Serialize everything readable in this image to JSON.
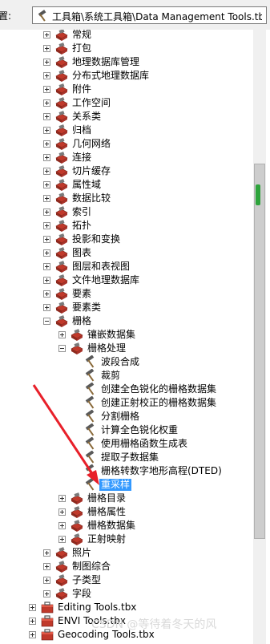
{
  "location_bar": {
    "label": "置:",
    "value": "工具箱\\系统工具箱\\Data Management Tools.tbx\\栅"
  },
  "tree": [
    {
      "label": "常规",
      "level": 1,
      "expand": "plus",
      "icon": "toolset"
    },
    {
      "label": "打包",
      "level": 1,
      "expand": "plus",
      "icon": "toolset"
    },
    {
      "label": "地理数据库管理",
      "level": 1,
      "expand": "plus",
      "icon": "toolset"
    },
    {
      "label": "分布式地理数据库",
      "level": 1,
      "expand": "plus",
      "icon": "toolset"
    },
    {
      "label": "附件",
      "level": 1,
      "expand": "plus",
      "icon": "toolset"
    },
    {
      "label": "工作空间",
      "level": 1,
      "expand": "plus",
      "icon": "toolset"
    },
    {
      "label": "关系类",
      "level": 1,
      "expand": "plus",
      "icon": "toolset"
    },
    {
      "label": "归档",
      "level": 1,
      "expand": "plus",
      "icon": "toolset"
    },
    {
      "label": "几何网络",
      "level": 1,
      "expand": "plus",
      "icon": "toolset"
    },
    {
      "label": "连接",
      "level": 1,
      "expand": "plus",
      "icon": "toolset"
    },
    {
      "label": "切片缓存",
      "level": 1,
      "expand": "plus",
      "icon": "toolset"
    },
    {
      "label": "属性域",
      "level": 1,
      "expand": "plus",
      "icon": "toolset"
    },
    {
      "label": "数据比较",
      "level": 1,
      "expand": "plus",
      "icon": "toolset"
    },
    {
      "label": "索引",
      "level": 1,
      "expand": "plus",
      "icon": "toolset"
    },
    {
      "label": "拓扑",
      "level": 1,
      "expand": "plus",
      "icon": "toolset"
    },
    {
      "label": "投影和变换",
      "level": 1,
      "expand": "plus",
      "icon": "toolset"
    },
    {
      "label": "图表",
      "level": 1,
      "expand": "plus",
      "icon": "toolset"
    },
    {
      "label": "图层和表视图",
      "level": 1,
      "expand": "plus",
      "icon": "toolset"
    },
    {
      "label": "文件地理数据库",
      "level": 1,
      "expand": "plus",
      "icon": "toolset"
    },
    {
      "label": "要素",
      "level": 1,
      "expand": "plus",
      "icon": "toolset"
    },
    {
      "label": "要素类",
      "level": 1,
      "expand": "plus",
      "icon": "toolset"
    },
    {
      "label": "栅格",
      "level": 1,
      "expand": "minus",
      "icon": "toolset"
    },
    {
      "label": "镶嵌数据集",
      "level": 2,
      "expand": "plus",
      "icon": "toolset"
    },
    {
      "label": "栅格处理",
      "level": 2,
      "expand": "minus",
      "icon": "toolset"
    },
    {
      "label": "波段合成",
      "level": 3,
      "expand": "none",
      "icon": "tool"
    },
    {
      "label": "裁剪",
      "level": 3,
      "expand": "none",
      "icon": "tool"
    },
    {
      "label": "创建全色锐化的栅格数据集",
      "level": 3,
      "expand": "none",
      "icon": "tool"
    },
    {
      "label": "创建正射校正的栅格数据集",
      "level": 3,
      "expand": "none",
      "icon": "tool"
    },
    {
      "label": "分割栅格",
      "level": 3,
      "expand": "none",
      "icon": "tool"
    },
    {
      "label": "计算全色锐化权重",
      "level": 3,
      "expand": "none",
      "icon": "tool"
    },
    {
      "label": "使用栅格函数生成表",
      "level": 3,
      "expand": "none",
      "icon": "tool"
    },
    {
      "label": "提取子数据集",
      "level": 3,
      "expand": "none",
      "icon": "tool"
    },
    {
      "label": "栅格转数字地形高程(DTED)",
      "level": 3,
      "expand": "none",
      "icon": "tool"
    },
    {
      "label": "重采样",
      "level": 3,
      "expand": "none",
      "icon": "tool",
      "selected": true
    },
    {
      "label": "栅格目录",
      "level": 2,
      "expand": "plus",
      "icon": "toolset"
    },
    {
      "label": "栅格属性",
      "level": 2,
      "expand": "plus",
      "icon": "toolset"
    },
    {
      "label": "栅格数据集",
      "level": 2,
      "expand": "plus",
      "icon": "toolset"
    },
    {
      "label": "正射映射",
      "level": 2,
      "expand": "plus",
      "icon": "toolset"
    },
    {
      "label": "照片",
      "level": 1,
      "expand": "plus",
      "icon": "toolset"
    },
    {
      "label": "制图综合",
      "level": 1,
      "expand": "plus",
      "icon": "toolset"
    },
    {
      "label": "子类型",
      "level": 1,
      "expand": "plus",
      "icon": "toolset"
    },
    {
      "label": "字段",
      "level": 1,
      "expand": "plus",
      "icon": "toolset"
    },
    {
      "label": "Editing Tools.tbx",
      "level": 0,
      "expand": "plus",
      "icon": "toolbox"
    },
    {
      "label": "ENVI Tools.tbx",
      "level": 0,
      "expand": "plus",
      "icon": "toolbox"
    },
    {
      "label": "Geocoding Tools.tbx",
      "level": 0,
      "expand": "plus",
      "icon": "toolbox"
    }
  ],
  "watermark": "CSDN @等待着冬天的风",
  "colors": {
    "selection": "#3399ff",
    "toolset_red": "#c0392b",
    "annotation_arrow": "#e8202a",
    "scroll_grip": "#2ea43c"
  }
}
